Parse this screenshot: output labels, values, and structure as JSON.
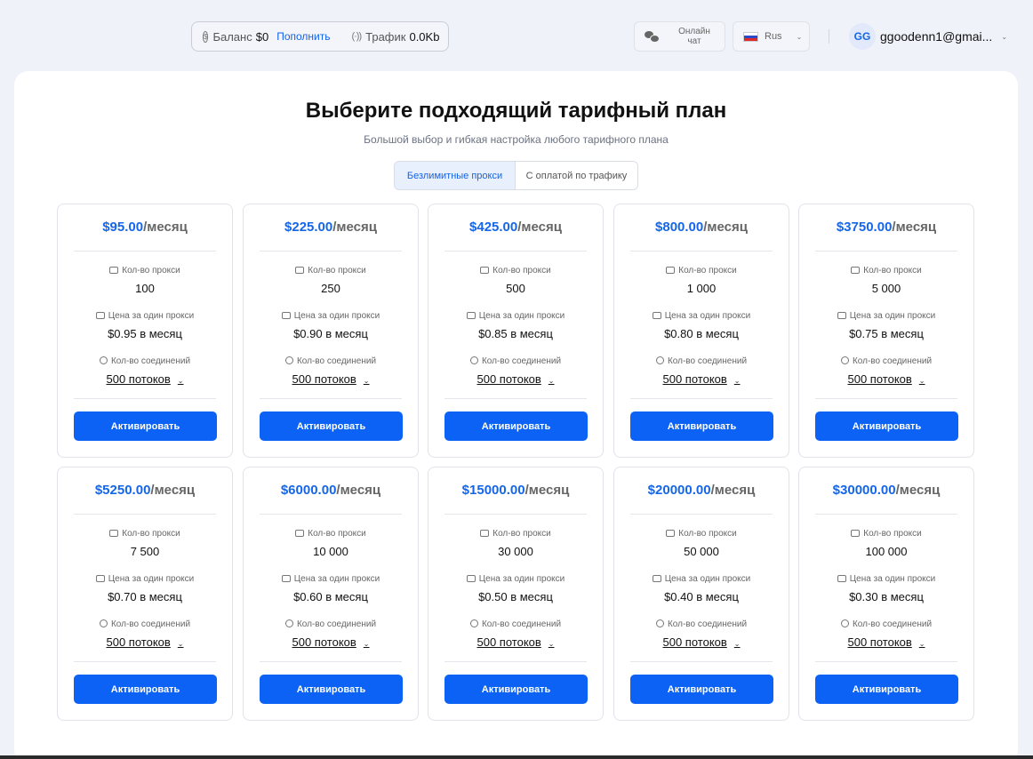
{
  "topbar": {
    "balance_label": "Баланс",
    "balance_value": "$0",
    "topup_link": "Пополнить",
    "traffic_label": "Трафик",
    "traffic_value": "0.0Kb",
    "chat_label": "Онлайн чат",
    "language": "Rus",
    "avatar_initials": "GG",
    "user_email": "ggoodenn1@gmai..."
  },
  "main": {
    "title": "Выберите подходящий тарифный план",
    "subtitle": "Большой выбор и гибкая настройка любого тарифного плана",
    "tabs": [
      {
        "label": "Безлимитные прокси",
        "active": true
      },
      {
        "label": "С оплатой по трафику",
        "active": false
      }
    ]
  },
  "card_labels": {
    "proxy_count": "Кол-во прокси",
    "price_per_proxy": "Цена за один прокси",
    "connections": "Кол-во соединений",
    "activate": "Активировать"
  },
  "plans": [
    {
      "price": "$95.00",
      "per": "/месяц",
      "proxies": "100",
      "unit_price": "$0.95 в месяц",
      "threads": "500 потоков"
    },
    {
      "price": "$225.00",
      "per": "/месяц",
      "proxies": "250",
      "unit_price": "$0.90 в месяц",
      "threads": "500 потоков"
    },
    {
      "price": "$425.00",
      "per": "/месяц",
      "proxies": "500",
      "unit_price": "$0.85 в месяц",
      "threads": "500 потоков"
    },
    {
      "price": "$800.00",
      "per": "/месяц",
      "proxies": "1 000",
      "unit_price": "$0.80 в месяц",
      "threads": "500 потоков"
    },
    {
      "price": "$3750.00",
      "per": "/месяц",
      "proxies": "5 000",
      "unit_price": "$0.75 в месяц",
      "threads": "500 потоков"
    },
    {
      "price": "$5250.00",
      "per": "/месяц",
      "proxies": "7 500",
      "unit_price": "$0.70 в месяц",
      "threads": "500 потоков"
    },
    {
      "price": "$6000.00",
      "per": "/месяц",
      "proxies": "10 000",
      "unit_price": "$0.60 в месяц",
      "threads": "500 потоков"
    },
    {
      "price": "$15000.00",
      "per": "/месяц",
      "proxies": "30 000",
      "unit_price": "$0.50 в месяц",
      "threads": "500 потоков"
    },
    {
      "price": "$20000.00",
      "per": "/месяц",
      "proxies": "50 000",
      "unit_price": "$0.40 в месяц",
      "threads": "500 потоков"
    },
    {
      "price": "$30000.00",
      "per": "/месяц",
      "proxies": "100 000",
      "unit_price": "$0.30 в месяц",
      "threads": "500 потоков"
    }
  ],
  "colors": {
    "accent": "#0b62f4",
    "price": "#1566e8"
  }
}
